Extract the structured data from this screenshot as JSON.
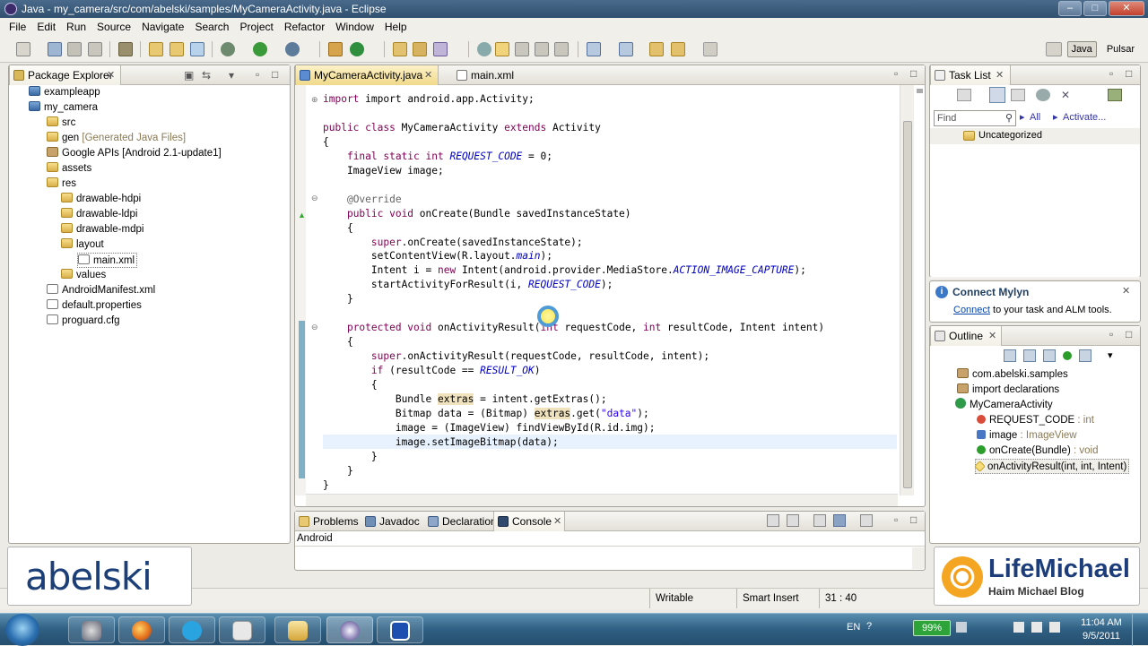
{
  "window": {
    "title": "Java - my_camera/src/com/abelski/samples/MyCameraActivity.java - Eclipse"
  },
  "menu": [
    "File",
    "Edit",
    "Run",
    "Source",
    "Navigate",
    "Search",
    "Project",
    "Refactor",
    "Window",
    "Help"
  ],
  "perspectives": {
    "java": "Java",
    "pulsar": "Pulsar"
  },
  "package_explorer": {
    "title": "Package Explorer",
    "items": [
      {
        "label": "exampleapp"
      },
      {
        "label": "my_camera"
      },
      {
        "label": "src"
      },
      {
        "label": "gen",
        "note": "[Generated Java Files]"
      },
      {
        "label": "Google APIs [Android 2.1-update1]"
      },
      {
        "label": "assets"
      },
      {
        "label": "res"
      },
      {
        "label": "drawable-hdpi"
      },
      {
        "label": "drawable-ldpi"
      },
      {
        "label": "drawable-mdpi"
      },
      {
        "label": "layout"
      },
      {
        "label": "main.xml"
      },
      {
        "label": "values"
      },
      {
        "label": "AndroidManifest.xml"
      },
      {
        "label": "default.properties"
      },
      {
        "label": "proguard.cfg"
      }
    ]
  },
  "editor": {
    "tabs": [
      {
        "label": "MyCameraActivity.java"
      },
      {
        "label": "main.xml"
      }
    ],
    "code": {
      "l1": "import android.app.Activity;",
      "l2a": "public class ",
      "l2b": "MyCameraActivity ",
      "l2c": "extends ",
      "l2d": "Activity",
      "l3": "{",
      "l4a": "final static int ",
      "l4b": "REQUEST_CODE",
      "l4c": " = 0;",
      "l5": "ImageView image;",
      "l6": "@Override",
      "l7a": "public void ",
      "l7b": "onCreate(Bundle savedInstanceState)",
      "l8": "{",
      "l9a": "super",
      "l9b": ".onCreate(savedInstanceState);",
      "l10a": "setContentView(R.layout.",
      "l10b": "main",
      "l10c": ");",
      "l11a": "Intent i = ",
      "l11b": "new ",
      "l11c": "Intent(android.provider.MediaStore.",
      "l11d": "ACTION_IMAGE_CAPTURE",
      "l11e": ");",
      "l12a": "startActivityForResult(i, ",
      "l12b": "REQUEST_CODE",
      "l12c": ");",
      "l13": "}",
      "l14a": "protected void ",
      "l14b": "onActivityResult(",
      "l14c": "int ",
      "l14d": "requestCode, ",
      "l14e": "int ",
      "l14f": "resultCode, Intent intent)",
      "l15": "{",
      "l16a": "super",
      "l16b": ".onActivityResult(requestCode, resultCode, intent);",
      "l17a": "if ",
      "l17b": "(resultCode == ",
      "l17c": "RESULT_OK",
      "l17d": ")",
      "l18": "{",
      "l19a": "Bundle ",
      "l19b": "extras",
      "l19c": " = intent.getExtras();",
      "l20a": "Bitmap data = (Bitmap) ",
      "l20b": "extras",
      "l20c": ".get(",
      "l20d": "\"data\"",
      "l20e": ");",
      "l21": "image = (ImageView) findViewById(R.id.img);",
      "l22": "image.setImageBitmap(data);",
      "l23": "}",
      "l24": "}",
      "l25": "}"
    }
  },
  "task_list": {
    "title": "Task List",
    "find_placeholder": "Find",
    "all": "All",
    "activate": "Activate...",
    "category": "Uncategorized"
  },
  "mylyn": {
    "title": "Connect Mylyn",
    "link": "Connect",
    "text": " to your task and ALM tools."
  },
  "outline": {
    "title": "Outline",
    "items": [
      {
        "label": "com.abelski.samples",
        "type": ""
      },
      {
        "label": "import declarations",
        "type": ""
      },
      {
        "label": "MyCameraActivity",
        "type": ""
      },
      {
        "label": "REQUEST_CODE",
        "type": " : int"
      },
      {
        "label": "image",
        "type": " : ImageView"
      },
      {
        "label": "onCreate(Bundle)",
        "type": " : void"
      },
      {
        "label": "onActivityResult(int, int, Intent)",
        "type": ""
      }
    ]
  },
  "bottom": {
    "tabs": [
      "Problems",
      "Javadoc",
      "Declaration",
      "Console"
    ],
    "console_label": "Android"
  },
  "status": {
    "writable": "Writable",
    "insert": "Smart Insert",
    "position": "31 : 40"
  },
  "watermarks": {
    "abelski": "abelski",
    "lifemichael": "LifeMichael",
    "blog": "Haim Michael Blog"
  },
  "taskbar": {
    "lang": "EN",
    "battery": "99%",
    "time": "11:04 AM",
    "date": "9/5/2011"
  }
}
